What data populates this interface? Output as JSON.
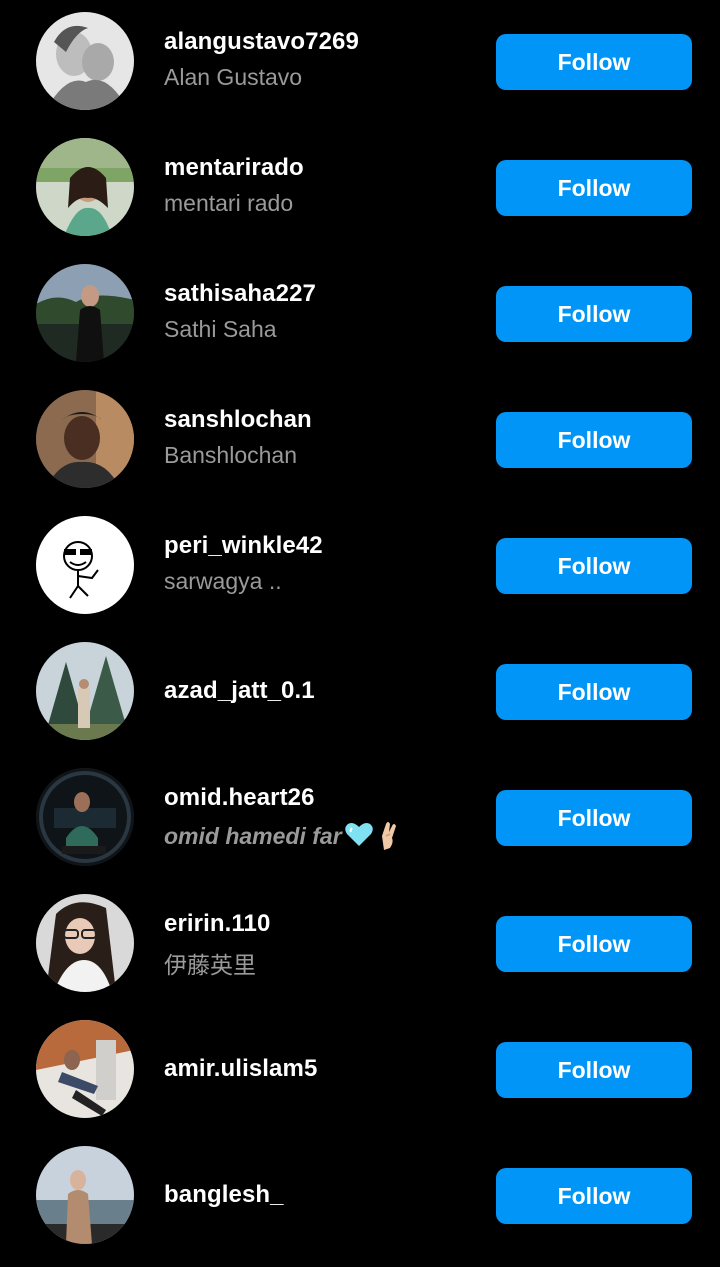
{
  "follow_label": "Follow",
  "accent_color": "#0095f6",
  "users": [
    {
      "username": "alangustavo7269",
      "full_name": "Alan Gustavo"
    },
    {
      "username": "mentarirado",
      "full_name": "mentari rado"
    },
    {
      "username": "sathisaha227",
      "full_name": "Sathi Saha"
    },
    {
      "username": "sanshlochan",
      "full_name": "Banshlochan"
    },
    {
      "username": "peri_winkle42",
      "full_name": "sarwagya .."
    },
    {
      "username": "azad_jatt_0.1",
      "full_name": ""
    },
    {
      "username": "omid.heart26",
      "full_name": "omid hamedi far"
    },
    {
      "username": "eririn.110",
      "full_name": "伊藤英里"
    },
    {
      "username": "amir.ulislam5",
      "full_name": ""
    },
    {
      "username": "banglesh_",
      "full_name": ""
    }
  ]
}
